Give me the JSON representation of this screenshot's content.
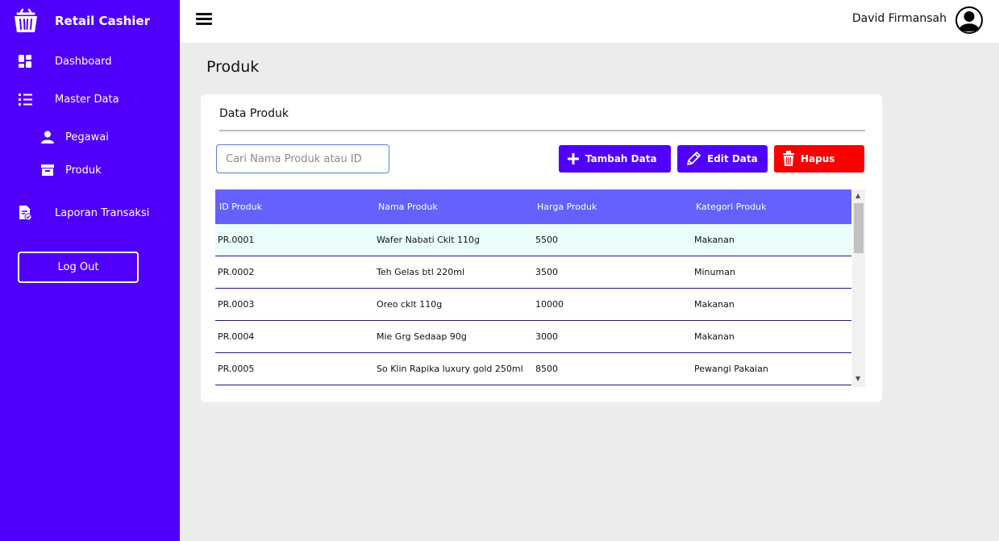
{
  "app": {
    "title": "Retail Cashier"
  },
  "sidebar": {
    "items": [
      {
        "label": "Dashboard",
        "icon": "dashboard-icon"
      },
      {
        "label": "Master Data",
        "icon": "list-icon"
      },
      {
        "label": "Pegawai",
        "icon": "person-icon"
      },
      {
        "label": "Produk",
        "icon": "box-icon"
      },
      {
        "label": "Laporan Transaksi",
        "icon": "report-icon"
      }
    ],
    "logout_label": "Log Out"
  },
  "header": {
    "user_name": "David Firmansah"
  },
  "page": {
    "title": "Produk"
  },
  "card": {
    "title": "Data Produk",
    "search_placeholder": "Cari Nama Produk atau ID",
    "buttons": {
      "add": "Tambah Data",
      "edit": "Edit Data",
      "delete": "Hapus"
    }
  },
  "table": {
    "columns": [
      "ID Produk",
      "Nama Produk",
      "Harga Produk",
      "Kategori Produk"
    ],
    "rows": [
      [
        "PR.0001",
        "Wafer Nabati Cklt 110g",
        "5500",
        "Makanan"
      ],
      [
        "PR.0002",
        "Teh Gelas btl 220ml",
        "3500",
        "Minuman"
      ],
      [
        "PR.0003",
        "Oreo cklt 110g",
        "10000",
        "Makanan"
      ],
      [
        "PR.0004",
        "Mie Grg Sedaap 90g",
        "3000",
        "Makanan"
      ],
      [
        "PR.0005",
        "So Klin Rapika luxury gold 250ml",
        "8500",
        "Pewangi Pakaian"
      ]
    ]
  },
  "colors": {
    "accent": "#5000fa",
    "table_header": "#6461ff",
    "danger": "#fc0000",
    "selected_row": "#eafffc"
  }
}
